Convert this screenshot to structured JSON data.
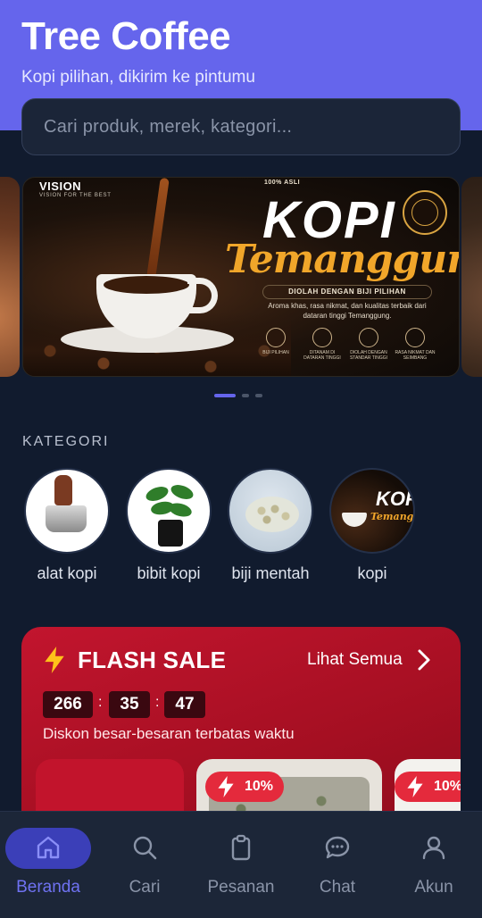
{
  "header": {
    "title": "Tree Coffee",
    "subtitle": "Kopi pilihan, dikirim ke pintumu"
  },
  "search": {
    "placeholder": "Cari produk, merek, kategori...",
    "value": ""
  },
  "banner": {
    "brand": "VISION",
    "brand_tagline": "VISION FOR THE BEST",
    "badge": "100% ASLI",
    "title": "KOPI",
    "title_script": "Temanggung",
    "ribbon": "DIOLAH DENGAN BIJI PILIHAN",
    "description": "Aroma khas, rasa nikmat, dan kualitas terbaik dari dataran tinggi Temanggung.",
    "features": [
      "BIJI PILIHAN",
      "DITANAM DI DATARAN TINGGI",
      "DIOLAH DENGAN STANDAR TINGGI",
      "RASA NIKMAT DAN SEIMBANG"
    ],
    "active_slide": 1,
    "slide_count": 3
  },
  "categories": {
    "label": "KATEGORI",
    "items": [
      {
        "label": "alat kopi"
      },
      {
        "label": "bibit kopi"
      },
      {
        "label": "biji mentah"
      },
      {
        "label": "kopi"
      }
    ]
  },
  "flash_sale": {
    "title": "FLASH SALE",
    "see_all": "Lihat Semua",
    "timer": {
      "hours": "266",
      "minutes": "35",
      "seconds": "47"
    },
    "description": "Diskon besar-besaran terbatas waktu",
    "products": [
      {
        "discount": "10%"
      },
      {
        "discount": "10%"
      }
    ]
  },
  "nav": {
    "items": [
      {
        "label": "Beranda",
        "icon": "home-icon",
        "active": true
      },
      {
        "label": "Cari",
        "icon": "search-icon",
        "active": false
      },
      {
        "label": "Pesanan",
        "icon": "clipboard-icon",
        "active": false
      },
      {
        "label": "Chat",
        "icon": "chat-icon",
        "active": false
      },
      {
        "label": "Akun",
        "icon": "user-icon",
        "active": false
      }
    ]
  },
  "colors": {
    "accent": "#6565ec",
    "background": "#111b2e",
    "flash_sale": "#c2152e",
    "nav_active": "#6f72f2"
  }
}
